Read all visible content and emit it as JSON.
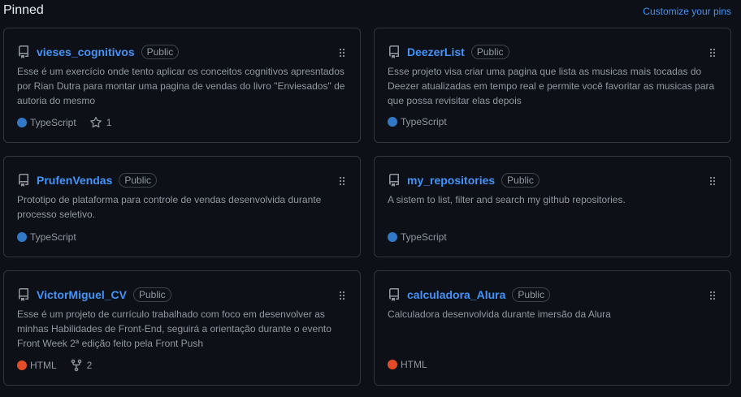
{
  "header": {
    "title": "Pinned",
    "customize_label": "Customize your pins"
  },
  "cards": [
    {
      "name": "vieses_cognitivos",
      "visibility": "Public",
      "description": "Esse é um exercício onde tento aplicar os conceitos cognitivos apresntados por Rian Dutra para montar uma pagina de vendas do livro \"Enviesados\" de autoria do mesmo",
      "language": "TypeScript",
      "language_color": "#3178c6",
      "stars": "1"
    },
    {
      "name": "DeezerList",
      "visibility": "Public",
      "description": "Esse projeto visa criar uma pagina que lista as musicas mais tocadas do Deezer atualizadas em tempo real e permite você favoritar as musicas para que possa revisitar elas depois",
      "language": "TypeScript",
      "language_color": "#3178c6"
    },
    {
      "name": "PrufenVendas",
      "visibility": "Public",
      "description": "Prototipo de plataforma para controle de vendas desenvolvida durante processo seletivo.",
      "language": "TypeScript",
      "language_color": "#3178c6"
    },
    {
      "name": "my_repositories",
      "visibility": "Public",
      "description": "A sistem to list, filter and search my github repositories.",
      "language": "TypeScript",
      "language_color": "#3178c6"
    },
    {
      "name": "VictorMiguel_CV",
      "visibility": "Public",
      "description": "Esse é um projeto de currículo trabalhado com foco em desenvolver as minhas Habilidades de Front-End, seguirá a orientação durante o evento Front Week 2ª edição feito pela Front Push",
      "language": "HTML",
      "language_color": "#e34c26",
      "forks": "2"
    },
    {
      "name": "calculadora_Alura",
      "visibility": "Public",
      "description": "Calculadora desenvolvida durante imersão da Alura",
      "language": "HTML",
      "language_color": "#e34c26"
    }
  ],
  "icons": {
    "repo": "repo-icon",
    "grip": "grabber-icon",
    "star": "star-icon",
    "fork": "fork-icon"
  }
}
